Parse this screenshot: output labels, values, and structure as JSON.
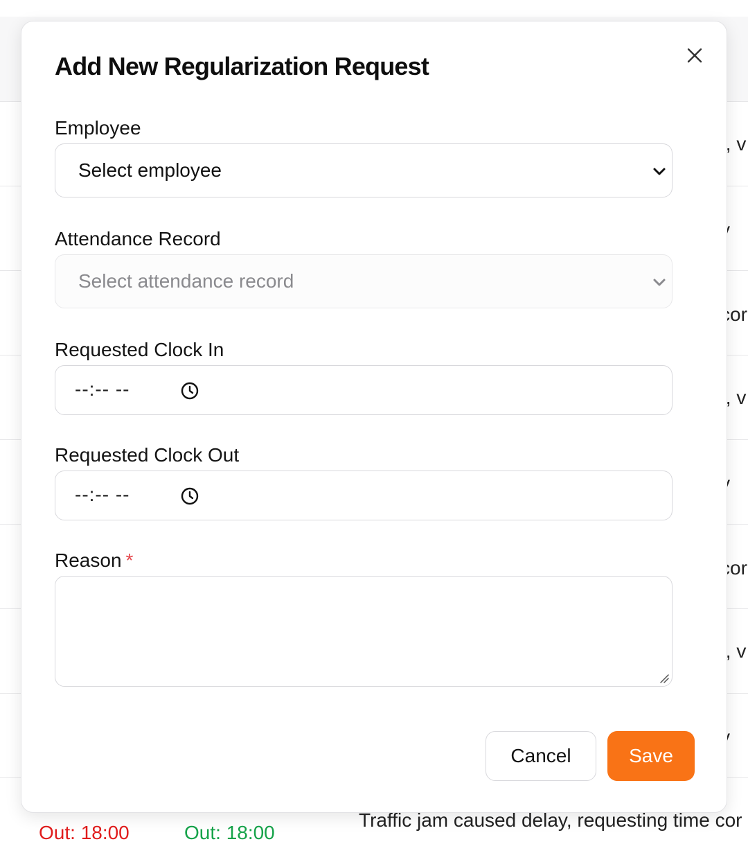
{
  "modal": {
    "title": "Add New Regularization Request",
    "close_icon": "close-icon",
    "fields": {
      "employee": {
        "label": "Employee",
        "value": "Select employee"
      },
      "attendance_record": {
        "label": "Attendance Record",
        "value": "Select attendance record",
        "disabled": true
      },
      "clock_in": {
        "label": "Requested Clock In",
        "value": "--:-- --"
      },
      "clock_out": {
        "label": "Requested Clock Out",
        "value": "--:-- --"
      },
      "reason": {
        "label": "Reason",
        "required_mark": "*",
        "value": ""
      }
    },
    "buttons": {
      "cancel": "Cancel",
      "save": "Save"
    }
  },
  "background": {
    "row_snippets": [
      "t, v",
      "y",
      "cor",
      "t, v",
      "y",
      "cor",
      "t, v",
      "y"
    ],
    "bottom_row": {
      "clock_out_1": "Out: 18:00",
      "clock_out_2": "Out: 18:00",
      "reason": "Traffic jam caused delay, requesting time cor"
    }
  },
  "colors": {
    "accent": "#f97316",
    "required": "#e5484d",
    "bottom_out_1": "#e11d1d",
    "bottom_out_2": "#16a34a"
  }
}
